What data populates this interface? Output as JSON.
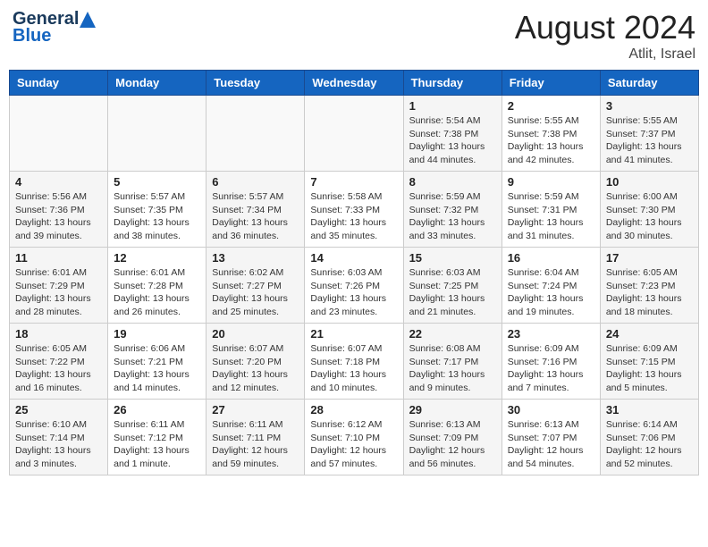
{
  "header": {
    "logo_general": "General",
    "logo_blue": "Blue",
    "month_year": "August 2024",
    "location": "Atlit, Israel"
  },
  "days_of_week": [
    "Sunday",
    "Monday",
    "Tuesday",
    "Wednesday",
    "Thursday",
    "Friday",
    "Saturday"
  ],
  "weeks": [
    {
      "days": [
        {
          "num": "",
          "info": "",
          "empty": true
        },
        {
          "num": "",
          "info": "",
          "empty": true
        },
        {
          "num": "",
          "info": "",
          "empty": true
        },
        {
          "num": "",
          "info": "",
          "empty": true
        },
        {
          "num": "1",
          "info": "Sunrise: 5:54 AM\nSunset: 7:38 PM\nDaylight: 13 hours\nand 44 minutes."
        },
        {
          "num": "2",
          "info": "Sunrise: 5:55 AM\nSunset: 7:38 PM\nDaylight: 13 hours\nand 42 minutes."
        },
        {
          "num": "3",
          "info": "Sunrise: 5:55 AM\nSunset: 7:37 PM\nDaylight: 13 hours\nand 41 minutes."
        }
      ]
    },
    {
      "days": [
        {
          "num": "4",
          "info": "Sunrise: 5:56 AM\nSunset: 7:36 PM\nDaylight: 13 hours\nand 39 minutes."
        },
        {
          "num": "5",
          "info": "Sunrise: 5:57 AM\nSunset: 7:35 PM\nDaylight: 13 hours\nand 38 minutes."
        },
        {
          "num": "6",
          "info": "Sunrise: 5:57 AM\nSunset: 7:34 PM\nDaylight: 13 hours\nand 36 minutes."
        },
        {
          "num": "7",
          "info": "Sunrise: 5:58 AM\nSunset: 7:33 PM\nDaylight: 13 hours\nand 35 minutes."
        },
        {
          "num": "8",
          "info": "Sunrise: 5:59 AM\nSunset: 7:32 PM\nDaylight: 13 hours\nand 33 minutes."
        },
        {
          "num": "9",
          "info": "Sunrise: 5:59 AM\nSunset: 7:31 PM\nDaylight: 13 hours\nand 31 minutes."
        },
        {
          "num": "10",
          "info": "Sunrise: 6:00 AM\nSunset: 7:30 PM\nDaylight: 13 hours\nand 30 minutes."
        }
      ]
    },
    {
      "days": [
        {
          "num": "11",
          "info": "Sunrise: 6:01 AM\nSunset: 7:29 PM\nDaylight: 13 hours\nand 28 minutes."
        },
        {
          "num": "12",
          "info": "Sunrise: 6:01 AM\nSunset: 7:28 PM\nDaylight: 13 hours\nand 26 minutes."
        },
        {
          "num": "13",
          "info": "Sunrise: 6:02 AM\nSunset: 7:27 PM\nDaylight: 13 hours\nand 25 minutes."
        },
        {
          "num": "14",
          "info": "Sunrise: 6:03 AM\nSunset: 7:26 PM\nDaylight: 13 hours\nand 23 minutes."
        },
        {
          "num": "15",
          "info": "Sunrise: 6:03 AM\nSunset: 7:25 PM\nDaylight: 13 hours\nand 21 minutes."
        },
        {
          "num": "16",
          "info": "Sunrise: 6:04 AM\nSunset: 7:24 PM\nDaylight: 13 hours\nand 19 minutes."
        },
        {
          "num": "17",
          "info": "Sunrise: 6:05 AM\nSunset: 7:23 PM\nDaylight: 13 hours\nand 18 minutes."
        }
      ]
    },
    {
      "days": [
        {
          "num": "18",
          "info": "Sunrise: 6:05 AM\nSunset: 7:22 PM\nDaylight: 13 hours\nand 16 minutes."
        },
        {
          "num": "19",
          "info": "Sunrise: 6:06 AM\nSunset: 7:21 PM\nDaylight: 13 hours\nand 14 minutes."
        },
        {
          "num": "20",
          "info": "Sunrise: 6:07 AM\nSunset: 7:20 PM\nDaylight: 13 hours\nand 12 minutes."
        },
        {
          "num": "21",
          "info": "Sunrise: 6:07 AM\nSunset: 7:18 PM\nDaylight: 13 hours\nand 10 minutes."
        },
        {
          "num": "22",
          "info": "Sunrise: 6:08 AM\nSunset: 7:17 PM\nDaylight: 13 hours\nand 9 minutes."
        },
        {
          "num": "23",
          "info": "Sunrise: 6:09 AM\nSunset: 7:16 PM\nDaylight: 13 hours\nand 7 minutes."
        },
        {
          "num": "24",
          "info": "Sunrise: 6:09 AM\nSunset: 7:15 PM\nDaylight: 13 hours\nand 5 minutes."
        }
      ]
    },
    {
      "days": [
        {
          "num": "25",
          "info": "Sunrise: 6:10 AM\nSunset: 7:14 PM\nDaylight: 13 hours\nand 3 minutes."
        },
        {
          "num": "26",
          "info": "Sunrise: 6:11 AM\nSunset: 7:12 PM\nDaylight: 13 hours\nand 1 minute."
        },
        {
          "num": "27",
          "info": "Sunrise: 6:11 AM\nSunset: 7:11 PM\nDaylight: 12 hours\nand 59 minutes."
        },
        {
          "num": "28",
          "info": "Sunrise: 6:12 AM\nSunset: 7:10 PM\nDaylight: 12 hours\nand 57 minutes."
        },
        {
          "num": "29",
          "info": "Sunrise: 6:13 AM\nSunset: 7:09 PM\nDaylight: 12 hours\nand 56 minutes."
        },
        {
          "num": "30",
          "info": "Sunrise: 6:13 AM\nSunset: 7:07 PM\nDaylight: 12 hours\nand 54 minutes."
        },
        {
          "num": "31",
          "info": "Sunrise: 6:14 AM\nSunset: 7:06 PM\nDaylight: 12 hours\nand 52 minutes."
        }
      ]
    }
  ]
}
